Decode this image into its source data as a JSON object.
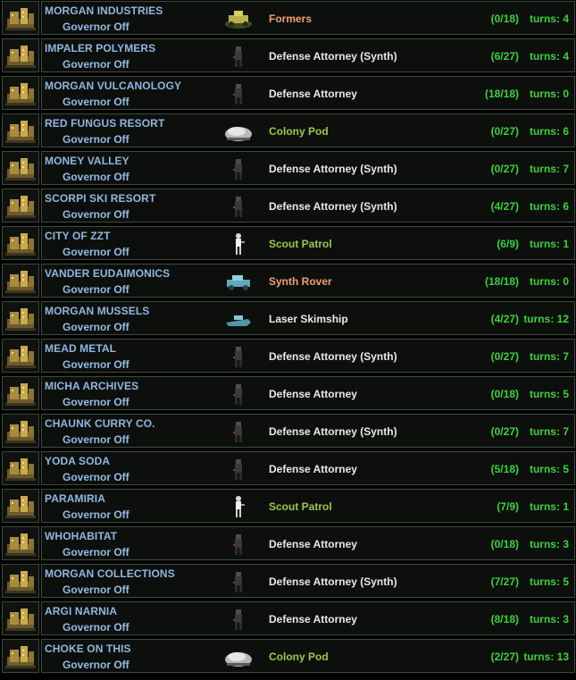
{
  "colors": {
    "base_name": "#8fb7e0",
    "governor": "#93bde4",
    "unit_orange": "#f0a070",
    "unit_white": "#e8e8e8",
    "unit_green": "#9cc84a",
    "progress_green": "#3ad23a"
  },
  "bases": [
    {
      "name": "MORGAN INDUSTRIES",
      "governor": "Governor Off",
      "unit": "Formers",
      "unit_color": "orange",
      "unit_icon": "formers-icon",
      "progress": "(0/18)",
      "turns": "turns:  4"
    },
    {
      "name": "IMPALER POLYMERS",
      "governor": "Governor Off",
      "unit": "Defense Attorney (Synth)",
      "unit_color": "white",
      "unit_icon": "infantry-icon",
      "progress": "(6/27)",
      "turns": "turns:  4"
    },
    {
      "name": "MORGAN VULCANOLOGY",
      "governor": "Governor Off",
      "unit": "Defense Attorney",
      "unit_color": "white",
      "unit_icon": "infantry-icon",
      "progress": "(18/18)",
      "turns": "turns:  0"
    },
    {
      "name": "RED FUNGUS RESORT",
      "governor": "Governor Off",
      "unit": "Colony Pod",
      "unit_color": "green",
      "unit_icon": "colony-pod-icon",
      "progress": "(0/27)",
      "turns": "turns:  6"
    },
    {
      "name": "MONEY VALLEY",
      "governor": "Governor Off",
      "unit": "Defense Attorney (Synth)",
      "unit_color": "white",
      "unit_icon": "infantry-icon",
      "progress": "(0/27)",
      "turns": "turns:  7"
    },
    {
      "name": "SCORPI SKI RESORT",
      "governor": "Governor Off",
      "unit": "Defense Attorney (Synth)",
      "unit_color": "white",
      "unit_icon": "infantry-icon",
      "progress": "(4/27)",
      "turns": "turns:  6"
    },
    {
      "name": "CITY OF ZZT",
      "governor": "Governor Off",
      "unit": "Scout Patrol",
      "unit_color": "green",
      "unit_icon": "scout-icon",
      "progress": "(6/9)",
      "turns": "turns:  1"
    },
    {
      "name": "VANDER EUDAIMONICS",
      "governor": "Governor Off",
      "unit": "Synth Rover",
      "unit_color": "orange",
      "unit_icon": "rover-icon",
      "progress": "(18/18)",
      "turns": "turns:  0"
    },
    {
      "name": "MORGAN MUSSELS",
      "governor": "Governor Off",
      "unit": "Laser Skimship",
      "unit_color": "white",
      "unit_icon": "skimship-icon",
      "progress": "(4/27)",
      "turns": "turns:  12"
    },
    {
      "name": "MEAD METAL",
      "governor": "Governor Off",
      "unit": "Defense Attorney (Synth)",
      "unit_color": "white",
      "unit_icon": "infantry-icon",
      "progress": "(0/27)",
      "turns": "turns:  7"
    },
    {
      "name": "MICHA ARCHIVES",
      "governor": "Governor Off",
      "unit": "Defense Attorney",
      "unit_color": "white",
      "unit_icon": "infantry-icon",
      "progress": "(0/18)",
      "turns": "turns:  5"
    },
    {
      "name": "CHAUNK CURRY CO.",
      "governor": "Governor Off",
      "unit": "Defense Attorney (Synth)",
      "unit_color": "white",
      "unit_icon": "infantry-icon",
      "progress": "(0/27)",
      "turns": "turns:  7"
    },
    {
      "name": "YODA SODA",
      "governor": "Governor Off",
      "unit": "Defense Attorney",
      "unit_color": "white",
      "unit_icon": "infantry-icon",
      "progress": "(5/18)",
      "turns": "turns:  5"
    },
    {
      "name": "PARAMIRIA",
      "governor": "Governor Off",
      "unit": "Scout Patrol",
      "unit_color": "green",
      "unit_icon": "scout-icon",
      "progress": "(7/9)",
      "turns": "turns:  1"
    },
    {
      "name": "WHOHABITAT",
      "governor": "Governor Off",
      "unit": "Defense Attorney",
      "unit_color": "white",
      "unit_icon": "infantry-icon",
      "progress": "(0/18)",
      "turns": "turns:  3"
    },
    {
      "name": "MORGAN COLLECTIONS",
      "governor": "Governor Off",
      "unit": "Defense Attorney (Synth)",
      "unit_color": "white",
      "unit_icon": "infantry-icon",
      "progress": "(7/27)",
      "turns": "turns:  5"
    },
    {
      "name": "ARGI NARNIA",
      "governor": "Governor Off",
      "unit": "Defense Attorney",
      "unit_color": "white",
      "unit_icon": "infantry-icon",
      "progress": "(8/18)",
      "turns": "turns:  3"
    },
    {
      "name": "CHOKE ON THIS",
      "governor": "Governor Off",
      "unit": "Colony Pod",
      "unit_color": "green",
      "unit_icon": "colony-pod-icon",
      "progress": "(2/27)",
      "turns": "turns:  13"
    }
  ]
}
